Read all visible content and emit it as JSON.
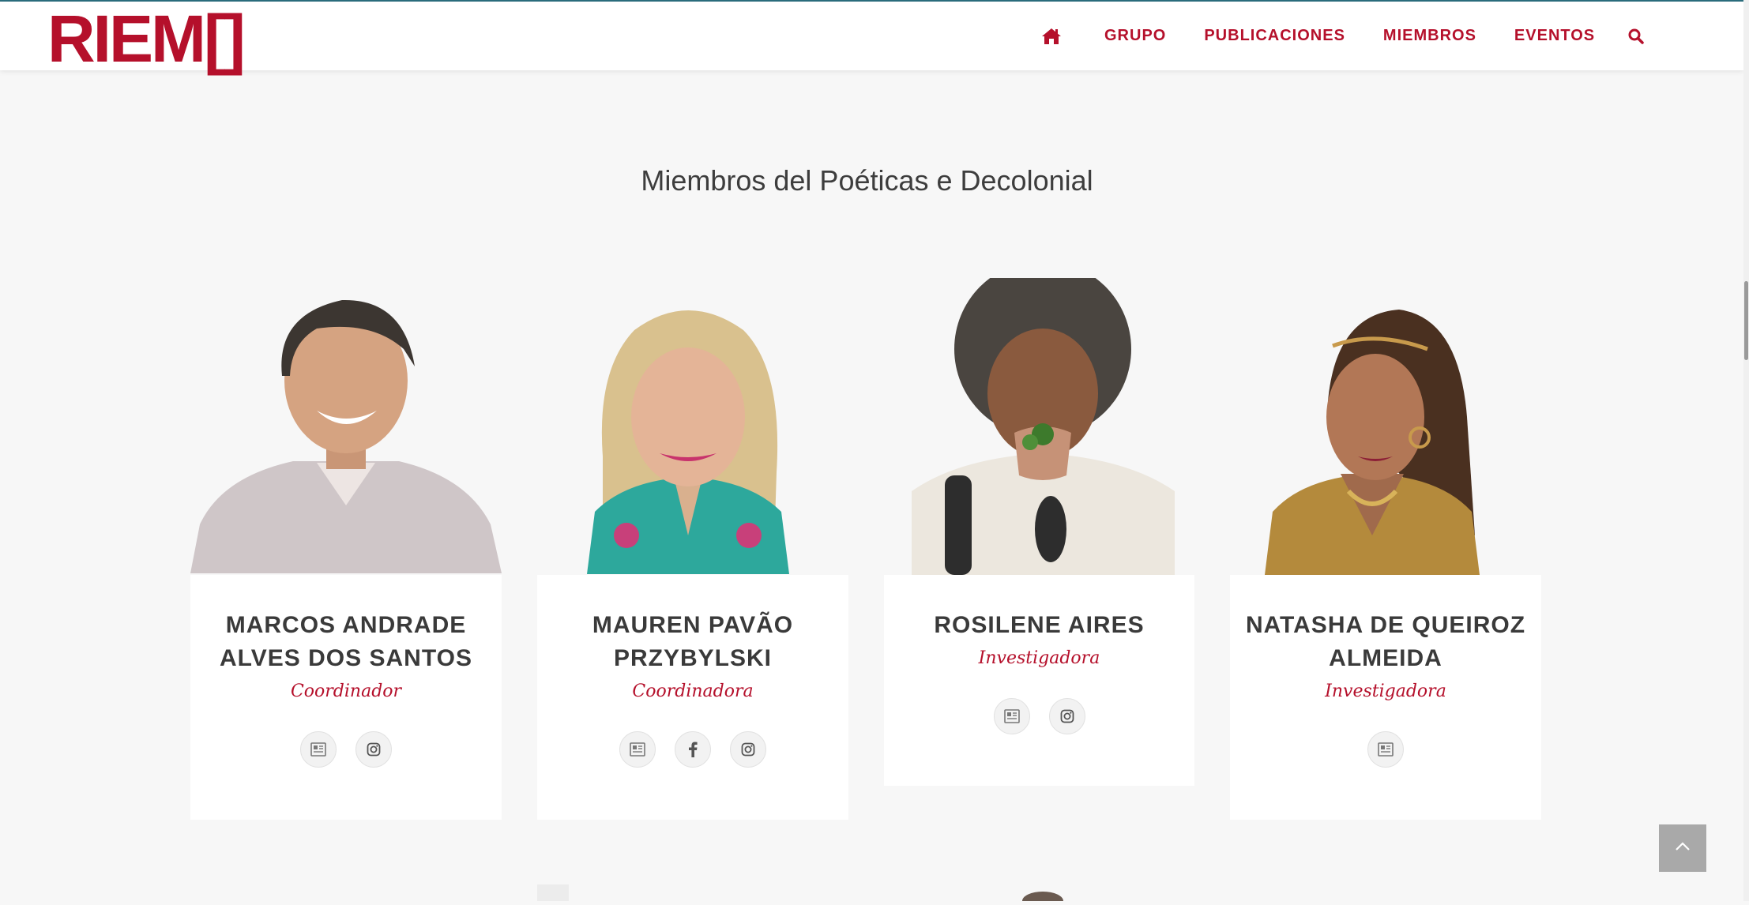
{
  "brand": {
    "logo_text": "RIEM[]",
    "accent": "#b5102b"
  },
  "nav": {
    "items": [
      {
        "label": "GRUPO"
      },
      {
        "label": "PUBLICACIONES"
      },
      {
        "label": "MIEMBROS"
      },
      {
        "label": "EVENTOS"
      }
    ],
    "icons": [
      "home-icon",
      "search-icon"
    ]
  },
  "main": {
    "title": "Miembros del Poéticas e Decolonial",
    "members": [
      {
        "name": "MARCOS ANDRADE ALVES DOS SANTOS",
        "role": "Coordinador",
        "social": [
          "lattes-icon",
          "instagram-icon"
        ]
      },
      {
        "name": "MAUREN PAVÃO PRZYBYLSKI",
        "role": "Coordinadora",
        "social": [
          "lattes-icon",
          "facebook-icon",
          "instagram-icon"
        ]
      },
      {
        "name": "ROSILENE AIRES",
        "role": "Investigadora",
        "social": [
          "lattes-icon",
          "instagram-icon"
        ]
      },
      {
        "name": "NATASHA DE QUEIROZ ALMEIDA",
        "role": "Investigadora",
        "social": [
          "lattes-icon"
        ]
      }
    ]
  },
  "ui": {
    "back_to_top_icon": "chevron-up-icon"
  }
}
